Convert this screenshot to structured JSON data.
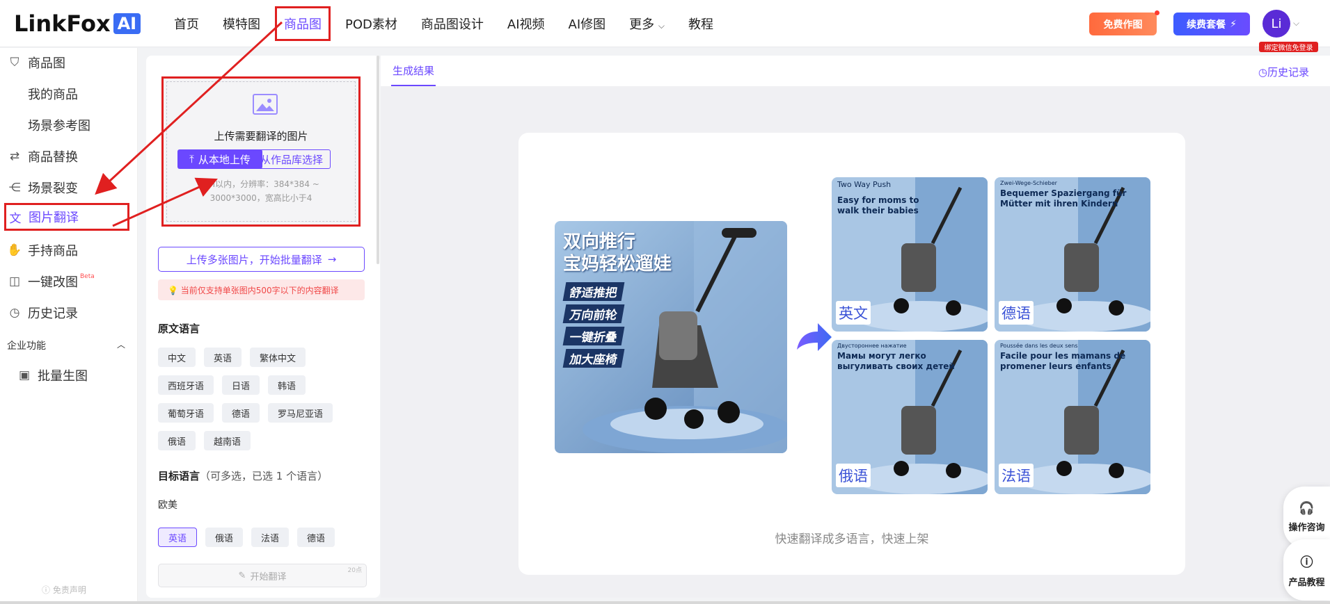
{
  "brand": {
    "name": "LinkFox",
    "badge": "AI"
  },
  "nav": {
    "items": [
      "首页",
      "模特图",
      "商品图",
      "POD素材",
      "商品图设计",
      "AI视频",
      "AI修图",
      "更多",
      "教程"
    ],
    "more_chevron": "chevron-down-icon"
  },
  "header": {
    "free_btn": "免费作图",
    "renew_btn": "续费套餐",
    "renew_icon": "⚡",
    "avatar_text": "Li",
    "avatar_badge": "绑定微信免登录"
  },
  "sidebar": {
    "items": [
      {
        "label": "商品图",
        "icon": "bag-icon"
      },
      {
        "label": "我的商品"
      },
      {
        "label": "场景参考图"
      },
      {
        "label": "商品替换",
        "icon": "swap-icon"
      },
      {
        "label": "场景裂变",
        "icon": "share-icon"
      },
      {
        "label": "图片翻译",
        "icon": "translate-icon"
      },
      {
        "label": "手持商品",
        "icon": "hand-icon"
      },
      {
        "label": "一键改图",
        "icon": "edit-icon",
        "badge": "Beta"
      },
      {
        "label": "历史记录",
        "icon": "history-icon"
      }
    ],
    "section": "企业功能",
    "section_items": [
      {
        "label": "批量生图",
        "icon": "image-icon"
      }
    ],
    "disclaimer": "免责声明"
  },
  "panel": {
    "upload_title": "上传需要翻译的图片",
    "btn_local": "从本地上传",
    "btn_library": "从作品库选择",
    "hint_line1": "4M以内，分辨率：384*384 ~",
    "hint_line2": "3000*3000，宽高比小于4",
    "batch_btn": "上传多张图片，开始批量翻译",
    "notice": "💡 当前仅支持单张图内500字以下的内容翻译",
    "source_title": "原文语言",
    "source_langs": [
      "中文",
      "英语",
      "繁体中文",
      "西班牙语",
      "日语",
      "韩语",
      "葡萄牙语",
      "德语",
      "罗马尼亚语",
      "俄语",
      "越南语"
    ],
    "target_title": "目标语言",
    "target_sub": "（可多选，已选 1 个语言）",
    "region": "欧美",
    "target_langs": [
      {
        "label": "英语",
        "selected": true
      },
      {
        "label": "俄语",
        "selected": false
      },
      {
        "label": "法语",
        "selected": false
      },
      {
        "label": "德语",
        "selected": false
      }
    ],
    "start_btn": "开始翻译",
    "points": "20点"
  },
  "main": {
    "tab": "生成结果",
    "history_link": "历史记录",
    "main_image_text": {
      "title1": "双向推行",
      "title2": "宝妈轻松遛娃",
      "features": [
        "舒适推把",
        "万向前轮",
        "一键折叠",
        "加大座椅"
      ]
    },
    "results": [
      {
        "lang": "英文",
        "tag": "Two Way Push",
        "caption": "Easy for moms to walk their babies"
      },
      {
        "lang": "德语",
        "tag": "Zwei-Wege-Schieber",
        "caption": "Bequemer Spaziergang für Mütter mit ihren Kindern"
      },
      {
        "lang": "俄语",
        "tag": "Двустороннее нажатие",
        "caption": "Мамы могут легко выгуливать своих детей"
      },
      {
        "lang": "法语",
        "tag": "Poussée dans les deux sens",
        "caption": "Facile pour les mamans de promener leurs enfants"
      }
    ],
    "caption": "快速翻译成多语言，快速上架"
  },
  "float": {
    "consult": "操作咨询",
    "tutorial": "产品教程"
  },
  "colors": {
    "accent": "#6b48ff",
    "highlight": "#e02020"
  }
}
